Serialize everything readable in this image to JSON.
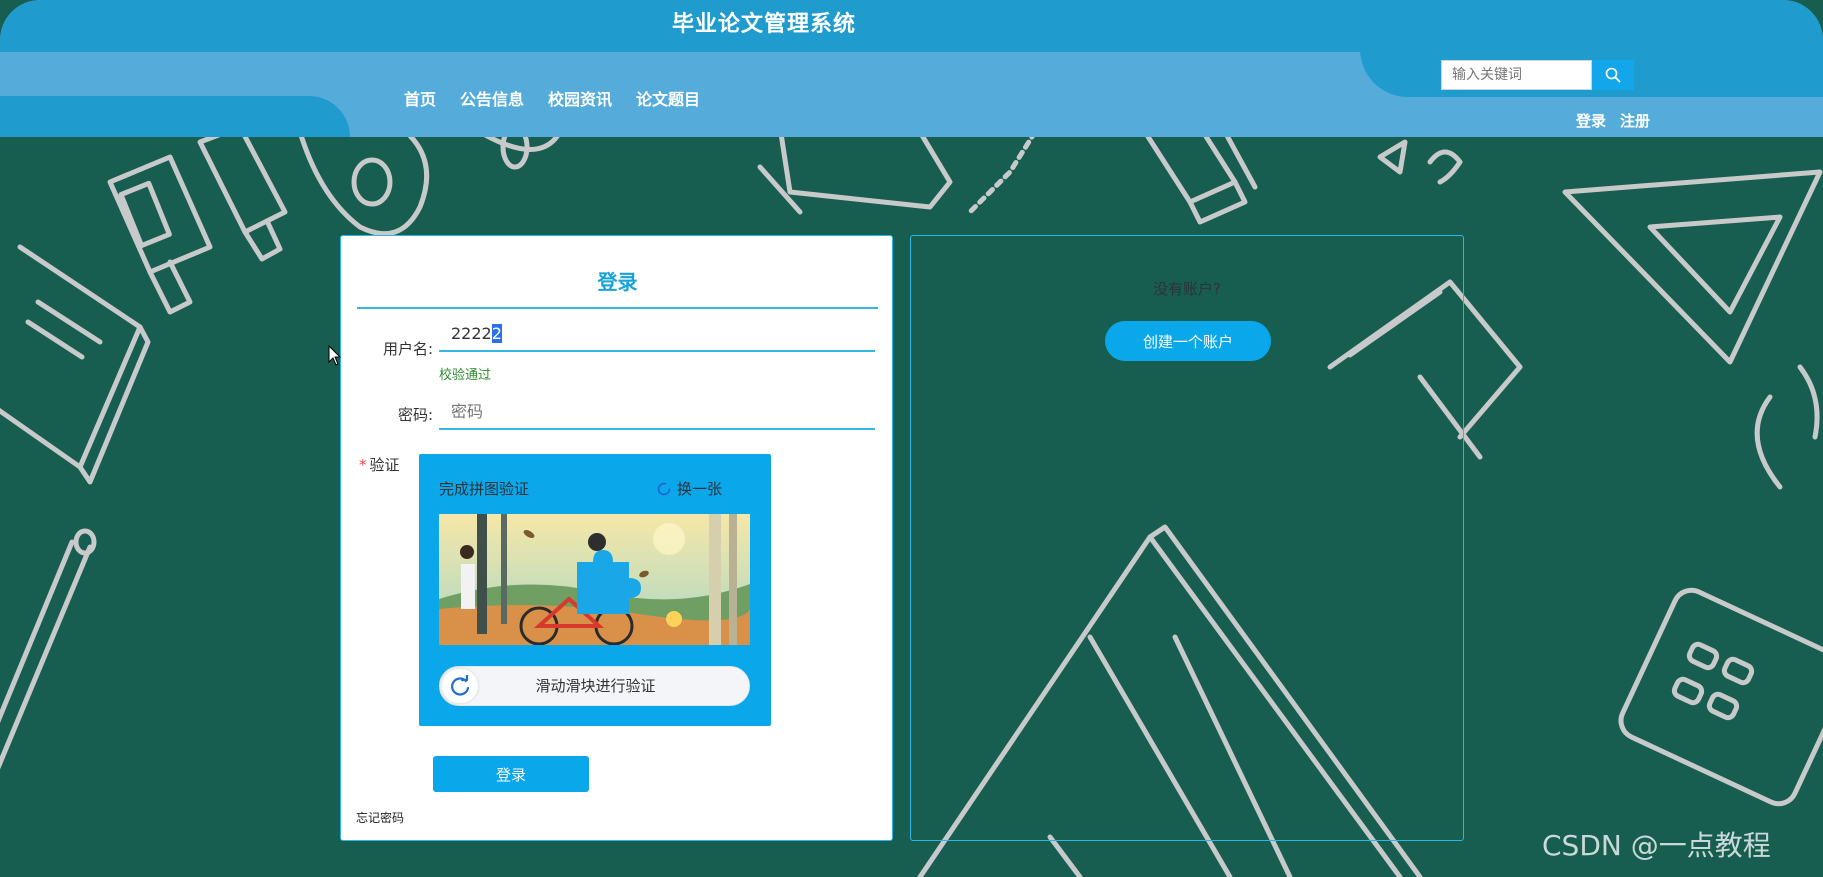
{
  "header": {
    "site_title": "毕业论文管理系统",
    "nav": [
      "首页",
      "公告信息",
      "校园资讯",
      "论文题目"
    ],
    "search_placeholder": "输入关键词",
    "login_link": "登录",
    "register_link": "注册"
  },
  "login": {
    "title": "登录",
    "username_label": "用户名:",
    "username_value_plain": "2222",
    "username_value_selected": "2",
    "validation_message": "校验通过",
    "password_label": "密码:",
    "password_placeholder": "密码",
    "captcha_label": "验证",
    "required_mark": "*",
    "captcha": {
      "title": "完成拼图验证",
      "refresh_label": "换一张",
      "slider_text": "滑动滑块进行验证"
    },
    "submit_label": "登录",
    "forgot_password": "忘记密码"
  },
  "register": {
    "prompt": "没有账户?",
    "create_button": "创建一个账户"
  },
  "watermark": "CSDN @一点教程",
  "colors": {
    "header_dark": "#1f9ccd",
    "header_light": "#55abd9",
    "background": "#175d50",
    "accent": "#0aa7ea",
    "doodle": "#c8c9cb"
  }
}
